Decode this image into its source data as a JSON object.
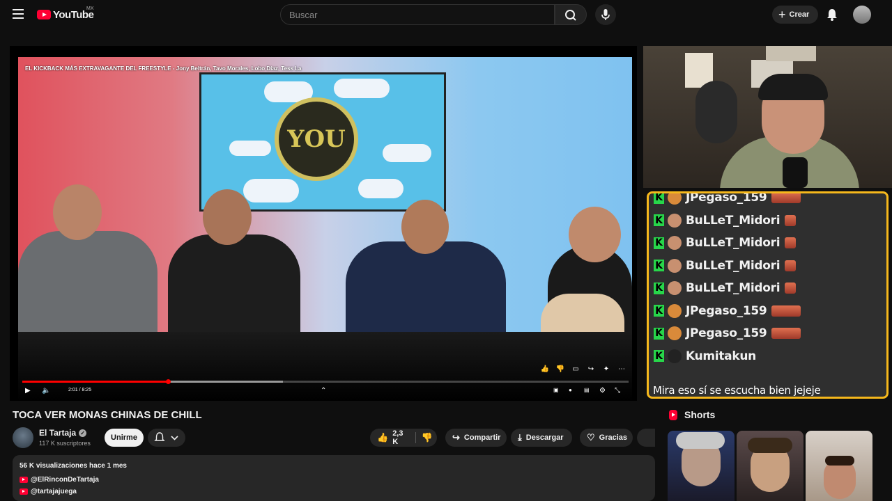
{
  "header": {
    "logo_text": "YouTube",
    "country_code": "MX",
    "search_placeholder": "Buscar",
    "create_label": "Crear"
  },
  "player": {
    "video_overlay_title": "EL KICKBACK MÁS EXTRAVAGANTE DEL FREESTYLE - Jony Beltrán, Tavo Morales, Lobo Díaz, Tess La",
    "time_display": "2:01 / 8:25",
    "progress_fraction": 0.24,
    "buffered_fraction": 0.43,
    "tv_logo_text": "YOU"
  },
  "chat": {
    "messages": [
      {
        "user": "JPegaso_159",
        "avatar_color": "#d98a3a"
      },
      {
        "user": "BuLLeT_Midori",
        "avatar_color": "#c89070"
      },
      {
        "user": "BuLLeT_Midori",
        "avatar_color": "#c89070"
      },
      {
        "user": "BuLLeT_Midori",
        "avatar_color": "#c89070"
      },
      {
        "user": "BuLLeT_Midori",
        "avatar_color": "#c89070"
      },
      {
        "user": "JPegaso_159",
        "avatar_color": "#d98a3a"
      },
      {
        "user": "JPegaso_159",
        "avatar_color": "#d98a3a"
      },
      {
        "user": "Kumitakun",
        "avatar_color": "#222222"
      }
    ],
    "last_message_text": "Mira eso sí se escucha bien jejeje",
    "border_color": "#f6b81c",
    "badge_color": "#27d64a"
  },
  "video": {
    "title": "TOCA VER MONAS CHINAS DE CHILL",
    "channel_name": "El Tartaja",
    "subscribers": "117 K suscriptores",
    "join_label": "Unirme",
    "likes": "2,3 K",
    "share_label": "Compartir",
    "download_label": "Descargar",
    "thanks_label": "Gracias"
  },
  "description": {
    "meta": "56 K visualizaciones  hace 1 mes",
    "links": [
      "@ElRinconDeTartaja",
      "@tartajajuega"
    ]
  },
  "shorts": {
    "header": "Shorts"
  }
}
